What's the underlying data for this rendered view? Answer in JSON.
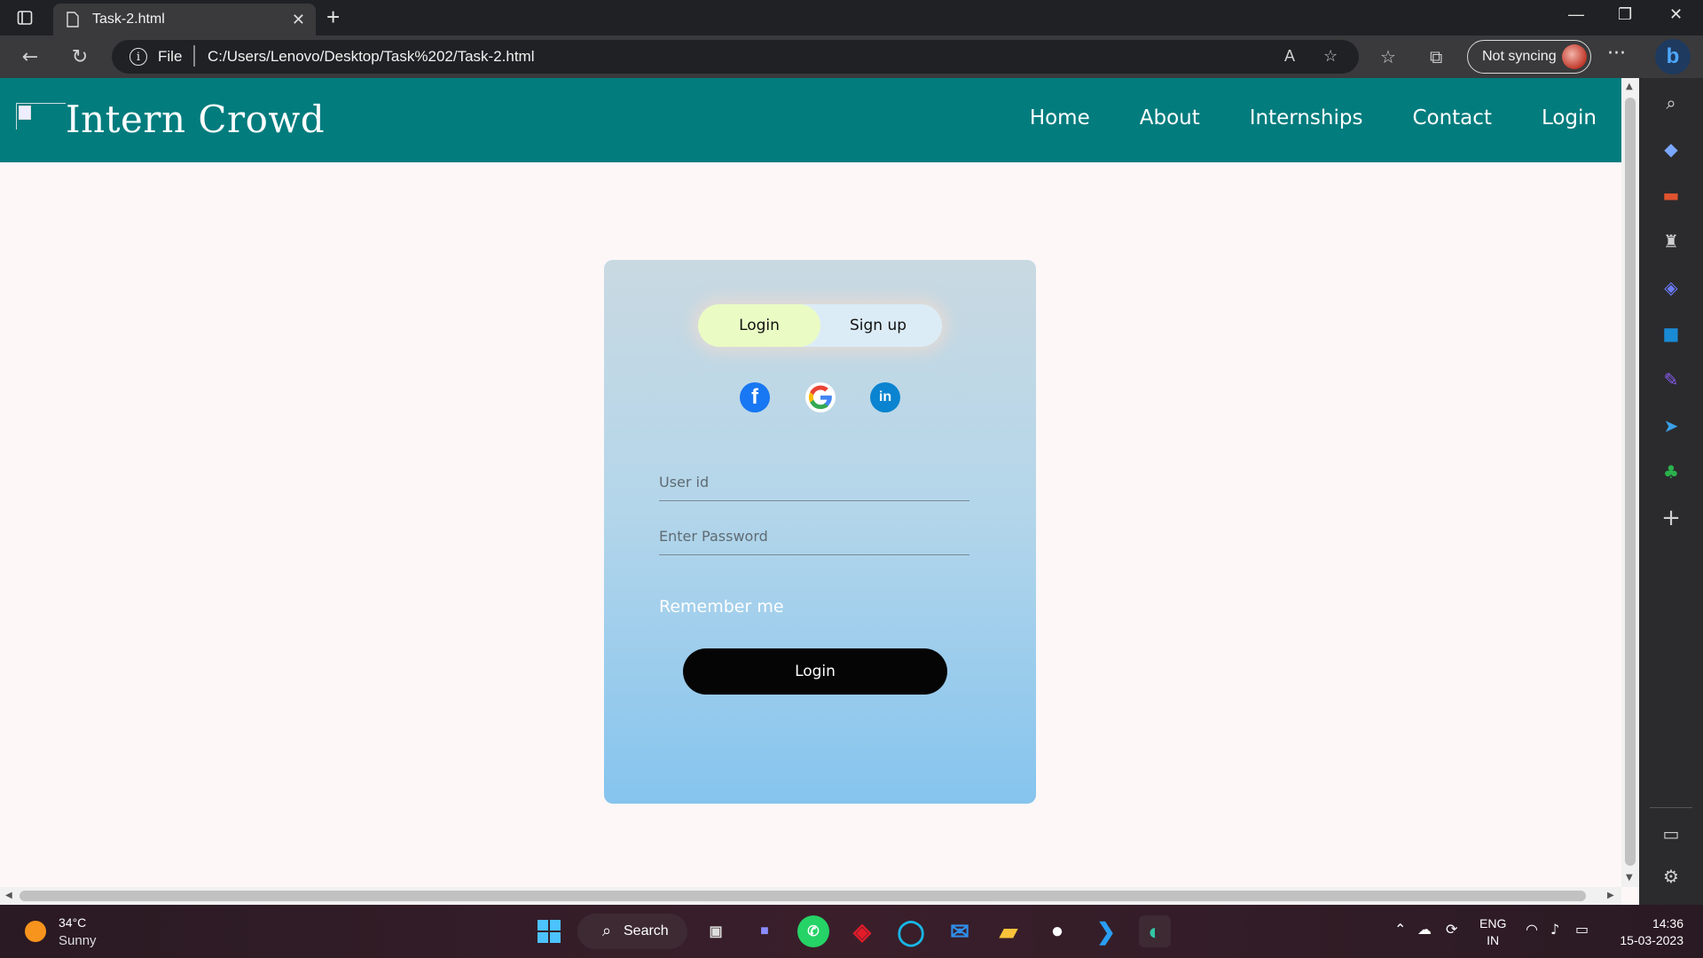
{
  "browser": {
    "tab_title": "Task-2.html",
    "new_tab_label": "+",
    "url_scheme": "File",
    "url": "C:/Users/Lenovo/Desktop/Task%202/Task-2.html",
    "sync_label": "Not syncing",
    "more_label": "···"
  },
  "site": {
    "brand": "Intern Crowd",
    "nav": [
      "Home",
      "About",
      "Internships",
      "Contact",
      "Login"
    ]
  },
  "form": {
    "tab_login": "Login",
    "tab_signup": "Sign up",
    "social": {
      "facebook": "f",
      "google": "G",
      "linkedin": "in"
    },
    "userid_placeholder": "User id",
    "password_placeholder": "Enter Password",
    "remember": "Remember me",
    "submit": "Login"
  },
  "taskbar": {
    "temperature": "34°C",
    "condition": "Sunny",
    "search_label": "Search",
    "lang_top": "ENG",
    "lang_bottom": "IN",
    "time": "14:36",
    "date": "15-03-2023"
  },
  "colors": {
    "nav_bg": "#037c7e",
    "card_top": "#c9d9e2",
    "card_bottom": "#86c4ee",
    "toggle_active": "#eafbc4",
    "submit_bg": "#050505"
  }
}
